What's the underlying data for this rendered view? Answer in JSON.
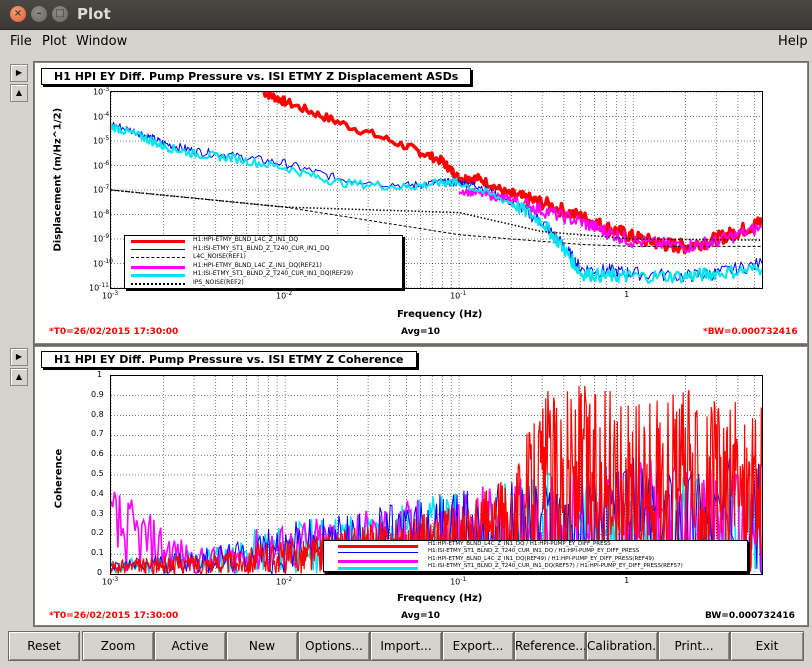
{
  "window": {
    "title": "Plot"
  },
  "menu": {
    "file": "File",
    "plot": "Plot",
    "window": "Window",
    "help": "Help"
  },
  "pad_buttons": {
    "right": "▶",
    "up": "▲"
  },
  "plot1": {
    "title": "H1 HPI EY Diff. Pump Pressure vs. ISI ETMY Z Displacement ASDs",
    "ylabel": "Displacement (m/Hz^1/2)",
    "xlabel": "Frequency (Hz)",
    "yticks": [
      "10",
      "10",
      "10",
      "10",
      "10",
      "10",
      "10",
      "10",
      "10"
    ],
    "yexp": [
      "-3",
      "-4",
      "-5",
      "-6",
      "-7",
      "-8",
      "-9",
      "-10",
      "-11"
    ],
    "xticks": [
      "10",
      "10",
      "1"
    ],
    "xexp": [
      "-3",
      "-2",
      ""
    ],
    "xtick_01": "10",
    "xexp_01": "-1",
    "t0": "*T0=26/02/2015 17:30:00",
    "avg": "Avg=10",
    "bw": "*BW=0.000732416",
    "legend": [
      {
        "label": "H1:HPI-ETMY_BLND_L4C_Z_IN1_DQ",
        "color": "#ff0000",
        "style": "thick"
      },
      {
        "label": "H1:ISI-ETMY_ST1_BLND_Z_T240_CUR_IN1_DQ",
        "color": "#0000ff",
        "style": "solid"
      },
      {
        "label": "L4C_NOISE(REF1)",
        "color": "#000000",
        "style": "dashed"
      },
      {
        "label": "H1:HPI-ETMY_BLND_L4C_Z_IN1_DQ(REF21)",
        "color": "#ff00ff",
        "style": "thick"
      },
      {
        "label": "H1:ISI-ETMY_ST1_BLND_Z_T240_CUR_IN1_DQ(REF29)",
        "color": "#00e5ee",
        "style": "thick"
      },
      {
        "label": "IPS_NOISE(REF2)",
        "color": "#000000",
        "style": "dotted"
      }
    ]
  },
  "plot2": {
    "title": "H1 HPI EY Diff. Pump Pressure vs. ISI ETMY Z Coherence",
    "ylabel": "Coherence",
    "xlabel": "Frequency (Hz)",
    "yticks": [
      "1",
      "0.9",
      "0.8",
      "0.7",
      "0.6",
      "0.5",
      "0.4",
      "0.3",
      "0.2",
      "0.1",
      "0"
    ],
    "xticks": [
      "10",
      "10",
      "10",
      "1"
    ],
    "xexp": [
      "-3",
      "-2",
      "-1",
      ""
    ],
    "t0": "*T0=26/02/2015 17:30:00",
    "avg": "Avg=10",
    "bw": "BW=0.000732416",
    "legend": [
      {
        "label": "H1:HPI-ETMY_BLND_L4C_Z_IN1_DQ / H1:HPI-PUMP_EY_DIFF_PRESS",
        "color": "#ff0000",
        "style": "thick"
      },
      {
        "label": "H1:ISI-ETMY_ST1_BLND_Z_T240_CUR_IN1_DQ / H1:HPI-PUMP_EY_DIFF_PRESS",
        "color": "#0000ff",
        "style": "solid"
      },
      {
        "label": "H1:HPI-ETMY_BLND_L4C_Z_IN1_DQ(REF49) / H1:HPI-PUMP_EY_DIFF_PRESS(REF49)",
        "color": "#ff00ff",
        "style": "thick"
      },
      {
        "label": "H1:ISI-ETMY_ST1_BLND_Z_T240_CUR_IN1_DQ(REF57) / H1:HPI-PUMP_EY_DIFF_PRESS(REF57)",
        "color": "#00e5ee",
        "style": "thick"
      }
    ]
  },
  "chart_data": [
    {
      "type": "line",
      "title": "H1 HPI EY Diff. Pump Pressure vs. ISI ETMY Z Displacement ASDs",
      "xlabel": "Frequency (Hz)",
      "ylabel": "Displacement (m/Hz^1/2)",
      "xscale": "log",
      "yscale": "log",
      "xlim": [
        0.001,
        5.5
      ],
      "ylim": [
        1e-11,
        0.001
      ],
      "grid": true,
      "legend_position": "bottom-left",
      "series": [
        {
          "name": "H1:HPI-ETMY_BLND_L4C_Z_IN1_DQ",
          "color": "#ff0000",
          "x": [
            0.0075,
            0.01,
            0.02,
            0.05,
            0.08,
            0.1,
            0.13,
            0.2,
            0.3,
            0.5,
            0.7,
            1,
            1.5,
            2,
            3,
            4,
            5.5
          ],
          "y": [
            0.001,
            0.0004,
            6e-05,
            6e-06,
            1.5e-06,
            3e-07,
            3e-07,
            6e-08,
            3e-08,
            8e-09,
            3e-09,
            1.2e-09,
            6e-10,
            5e-10,
            1e-09,
            2e-09,
            5e-09
          ]
        },
        {
          "name": "H1:ISI-ETMY_ST1_BLND_Z_T240_CUR_IN1_DQ",
          "color": "#0000ff",
          "x": [
            0.001,
            0.0015,
            0.002,
            0.003,
            0.005,
            0.01,
            0.02,
            0.05,
            0.08,
            0.1,
            0.13,
            0.2,
            0.3,
            0.4,
            0.5,
            0.7,
            1,
            2,
            3,
            5.5
          ],
          "y": [
            5e-05,
            2e-05,
            8e-06,
            4e-06,
            2.5e-06,
            1.2e-06,
            3e-07,
            1.5e-07,
            2e-07,
            2e-07,
            1.5e-07,
            3e-08,
            5e-09,
            5e-10,
            6e-11,
            5e-11,
            4e-11,
            3e-11,
            4e-11,
            1e-10
          ]
        },
        {
          "name": "L4C_NOISE(REF1)",
          "color": "#000000",
          "x": [
            0.001,
            0.01,
            0.1,
            0.2,
            0.3,
            0.5,
            1,
            5.5
          ],
          "y": [
            1e-07,
            2e-08,
            1.5e-09,
            1e-09,
            8e-10,
            6e-10,
            5e-10,
            5e-10
          ]
        },
        {
          "name": "H1:HPI-ETMY_BLND_L4C_Z_IN1_DQ(REF21)",
          "color": "#ff00ff",
          "x": [
            0.1,
            0.15,
            0.2,
            0.3,
            0.5,
            0.7,
            1,
            2,
            3,
            5.5
          ],
          "y": [
            1e-07,
            6e-08,
            4e-08,
            1.5e-08,
            5e-09,
            2e-09,
            8e-10,
            5e-10,
            8e-10,
            3e-09
          ]
        },
        {
          "name": "H1:ISI-ETMY_ST1_BLND_Z_T240_CUR_IN1_DQ(REF29)",
          "color": "#00e5ee",
          "x": [
            0.001,
            0.0015,
            0.002,
            0.003,
            0.005,
            0.01,
            0.02,
            0.05,
            0.08,
            0.1,
            0.2,
            0.3,
            0.4,
            0.5,
            0.7,
            1,
            2,
            3,
            5.5
          ],
          "y": [
            4e-05,
            1.5e-05,
            6e-06,
            3e-06,
            2e-06,
            8e-07,
            2e-07,
            1.3e-07,
            2e-07,
            2e-07,
            3e-08,
            5e-09,
            4e-10,
            4e-11,
            3e-11,
            3e-11,
            3e-11,
            4e-11,
            6e-11
          ]
        },
        {
          "name": "IPS_NOISE(REF2)",
          "color": "#000000",
          "x": [
            0.001,
            0.01,
            0.1,
            0.3,
            1,
            5.5
          ],
          "y": [
            1e-07,
            2e-08,
            1.2e-08,
            2e-09,
            1e-09,
            9e-10
          ]
        }
      ]
    },
    {
      "type": "line",
      "title": "H1 HPI EY Diff. Pump Pressure vs. ISI ETMY Z Coherence",
      "xlabel": "Frequency (Hz)",
      "ylabel": "Coherence",
      "xscale": "log",
      "xlim": [
        0.001,
        5.5
      ],
      "ylim": [
        0,
        1
      ],
      "grid": true,
      "legend_position": "bottom-right",
      "series": [
        {
          "name": "H1:HPI-ETMY_BLND_L4C_Z_IN1_DQ / H1:HPI-PUMP_EY_DIFF_PRESS",
          "color": "#ff0000",
          "x": [
            0.001,
            0.003,
            0.01,
            0.03,
            0.1,
            0.2,
            0.3,
            0.5,
            1,
            2,
            5.5
          ],
          "y": [
            0.05,
            0.08,
            0.1,
            0.15,
            0.2,
            0.3,
            0.55,
            0.6,
            0.5,
            0.55,
            0.5
          ]
        },
        {
          "name": "H1:ISI-ETMY_ST1_BLND_Z_T240_CUR_IN1_DQ / H1:HPI-PUMP_EY_DIFF_PRESS",
          "color": "#0000ff",
          "x": [
            0.001,
            0.003,
            0.01,
            0.03,
            0.1,
            0.3,
            1,
            5.5
          ],
          "y": [
            0.05,
            0.1,
            0.15,
            0.2,
            0.25,
            0.3,
            0.35,
            0.35
          ]
        },
        {
          "name": "H1:HPI-ETMY_BLND_L4C_Z_IN1_DQ(REF49) / H1:HPI-PUMP_EY_DIFF_PRESS(REF49)",
          "color": "#ff00ff",
          "x": [
            0.001,
            0.002,
            0.003,
            0.01,
            0.03,
            0.1,
            0.3,
            1,
            5.5
          ],
          "y": [
            0.35,
            0.2,
            0.1,
            0.15,
            0.2,
            0.25,
            0.3,
            0.35,
            0.3
          ]
        },
        {
          "name": "H1:ISI-ETMY_ST1_BLND_Z_T240_CUR_IN1_DQ(REF57) / H1:HPI-PUMP_EY_DIFF_PRESS(REF57)",
          "color": "#00e5ee",
          "x": [
            0.001,
            0.003,
            0.01,
            0.03,
            0.1,
            0.3,
            1,
            5.5
          ],
          "y": [
            0.05,
            0.1,
            0.15,
            0.2,
            0.25,
            0.3,
            0.3,
            0.3
          ]
        }
      ]
    }
  ],
  "buttons": [
    "Reset",
    "Zoom",
    "Active",
    "New",
    "Options...",
    "Import...",
    "Export...",
    "Reference...",
    "Calibration...",
    "Print...",
    "Exit"
  ]
}
